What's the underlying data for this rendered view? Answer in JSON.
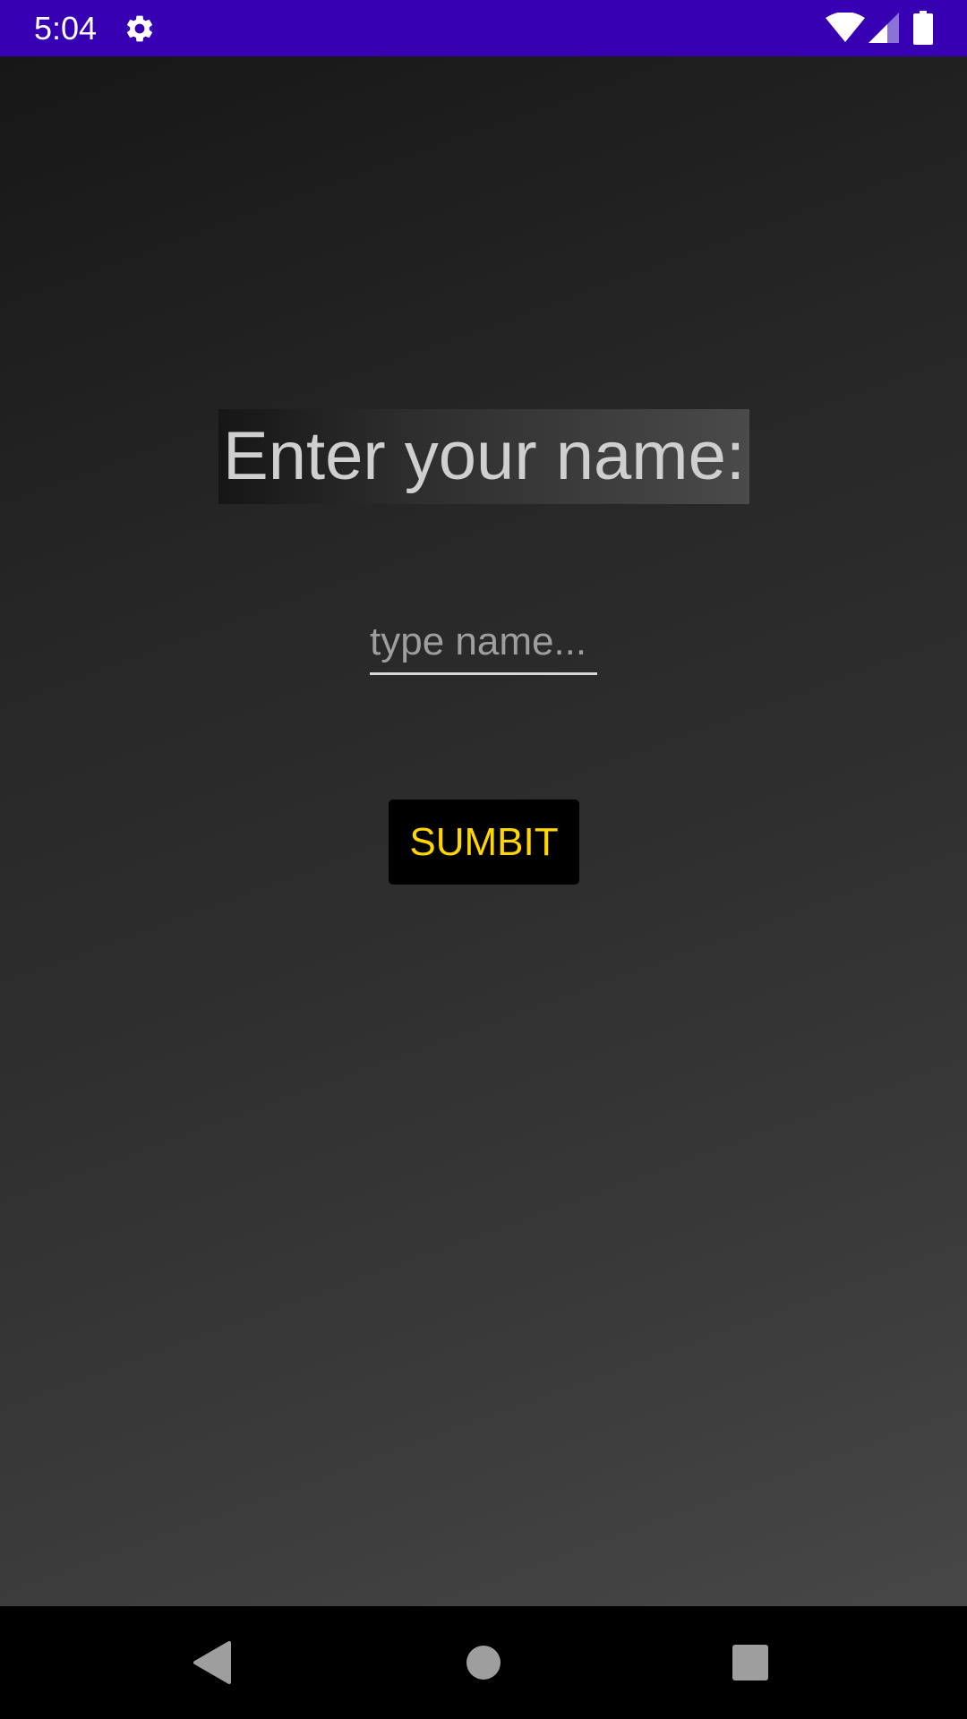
{
  "status_bar": {
    "time": "5:04",
    "background_color": "#3700b3",
    "icons": [
      "gear-icon",
      "wifi-icon",
      "signal-icon",
      "battery-icon"
    ]
  },
  "main": {
    "title": "Enter your name:",
    "name_input": {
      "value": "",
      "placeholder": "type name..."
    },
    "submit_label": "SUMBIT",
    "submit_text_color": "#ffd600"
  },
  "nav_bar": {
    "icons": [
      "back-icon",
      "home-icon",
      "recents-icon"
    ]
  }
}
